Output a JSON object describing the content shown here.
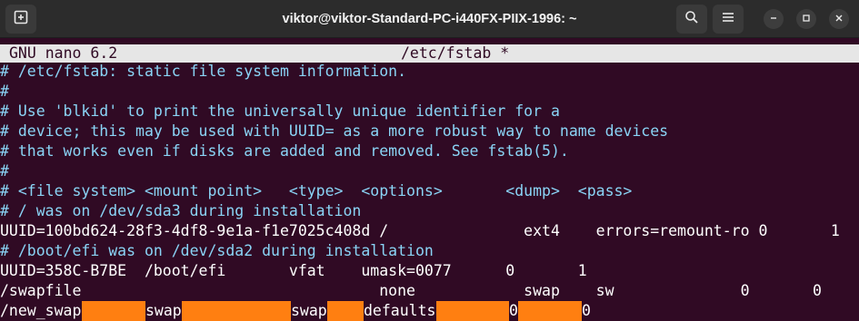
{
  "window": {
    "title": "viktor@viktor-Standard-PC-i440FX-PIIX-1996: ~"
  },
  "icons": {
    "new_tab": "new-tab-icon",
    "search": "search-icon",
    "menu": "hamburger-menu-icon",
    "minimize": "minimize-icon",
    "maximize": "maximize-icon",
    "close": "close-icon"
  },
  "colors": {
    "terminal_bg": "#300a24",
    "header_bg": "#e6e6e6",
    "comment": "#8ad4f6",
    "text": "#ffffff",
    "tab_highlight": "#ff7f11"
  },
  "nano": {
    "version": "GNU nano 6.2",
    "file": "/etc/fstab *"
  },
  "lines": [
    {
      "text": "# /etc/fstab: static file system information.",
      "comment": true
    },
    {
      "text": "#",
      "comment": true
    },
    {
      "text": "# Use 'blkid' to print the universally unique identifier for a",
      "comment": true
    },
    {
      "text": "# device; this may be used with UUID= as a more robust way to name devices",
      "comment": true
    },
    {
      "text": "# that works even if disks are added and removed. See fstab(5).",
      "comment": true
    },
    {
      "text": "#",
      "comment": true
    },
    {
      "text": "# <file system> <mount point>   <type>  <options>       <dump>  <pass>",
      "comment": true
    },
    {
      "text": "# / was on /dev/sda3 during installation",
      "comment": true
    },
    {
      "text": "UUID=100bd624-28f3-4df8-9e1a-f1e7025c408d /               ext4    errors=remount-ro 0       1",
      "comment": false
    },
    {
      "text": "# /boot/efi was on /dev/sda2 during installation",
      "comment": true
    },
    {
      "text": "UUID=358C-B7BE  /boot/efi       vfat    umask=0077      0       1",
      "comment": false
    },
    {
      "text": "/swapfile                                 none            swap    sw              0       0",
      "comment": false
    }
  ],
  "edit_line": {
    "fields": [
      "/new_swap",
      "swap",
      "swap",
      "defaults",
      "0",
      "0"
    ]
  }
}
